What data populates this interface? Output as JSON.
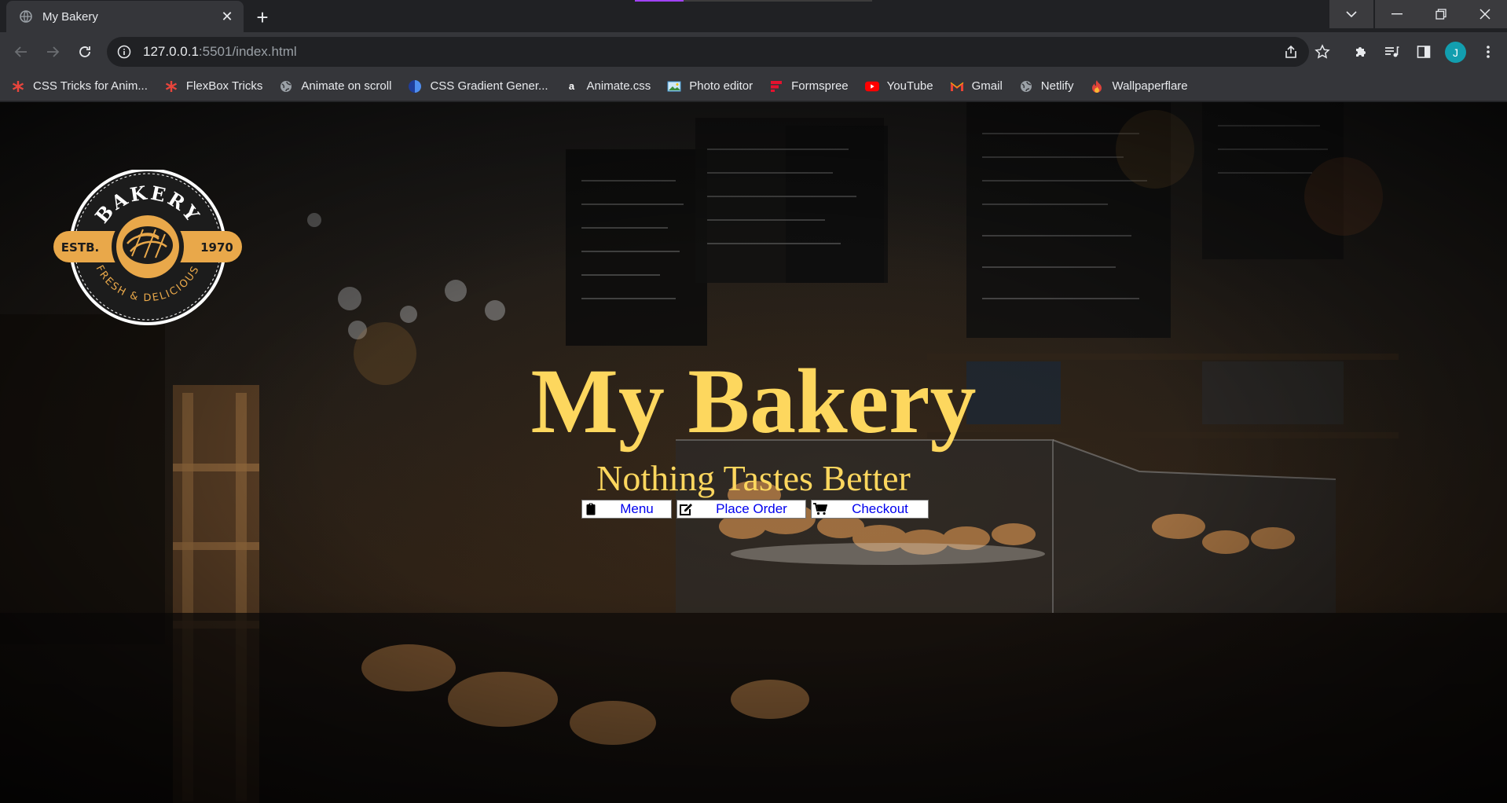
{
  "browser": {
    "tab_title": "My Bakery",
    "url_host": "127.0.0.1",
    "url_rest": ":5501/index.html",
    "profile_initial": "J"
  },
  "bookmarks": [
    {
      "label": "CSS Tricks for Anim...",
      "icon": "asterisk-icon",
      "color": "#e8453c"
    },
    {
      "label": "FlexBox Tricks",
      "icon": "asterisk-icon",
      "color": "#e8453c"
    },
    {
      "label": "Animate on scroll",
      "icon": "globe-icon",
      "color": "#9aa0a6"
    },
    {
      "label": "CSS Gradient Gener...",
      "icon": "gradient-icon",
      "color": "#3f6fd8"
    },
    {
      "label": "Animate.css",
      "icon": "animate-icon",
      "color": "#ffffff"
    },
    {
      "label": "Photo editor",
      "icon": "photo-icon",
      "color": "#4aa3df"
    },
    {
      "label": "Formspree",
      "icon": "formspree-icon",
      "color": "#e5122e"
    },
    {
      "label": "YouTube",
      "icon": "youtube-icon",
      "color": "#ff0000"
    },
    {
      "label": "Gmail",
      "icon": "gmail-icon",
      "color": "#ea4335"
    },
    {
      "label": "Netlify",
      "icon": "globe-icon",
      "color": "#9aa0a6"
    },
    {
      "label": "Wallpaperflare",
      "icon": "flame-icon",
      "color": "#e0433a"
    }
  ],
  "page": {
    "logo": {
      "top_text": "BAKERY",
      "left_text": "ESTB.",
      "right_text": "1970",
      "bottom_text": "FRESH & DELICIOUS"
    },
    "title": "My Bakery",
    "subtitle": "Nothing Tastes Better",
    "buttons": [
      {
        "label": "Menu",
        "icon": "clipboard-icon"
      },
      {
        "label": "Place Order",
        "icon": "edit-icon"
      },
      {
        "label": "Checkout",
        "icon": "cart-icon"
      }
    ]
  },
  "colors": {
    "accent": "#fdd75e",
    "logo_gold": "#e9a84a",
    "link_blue": "#0000ee"
  }
}
